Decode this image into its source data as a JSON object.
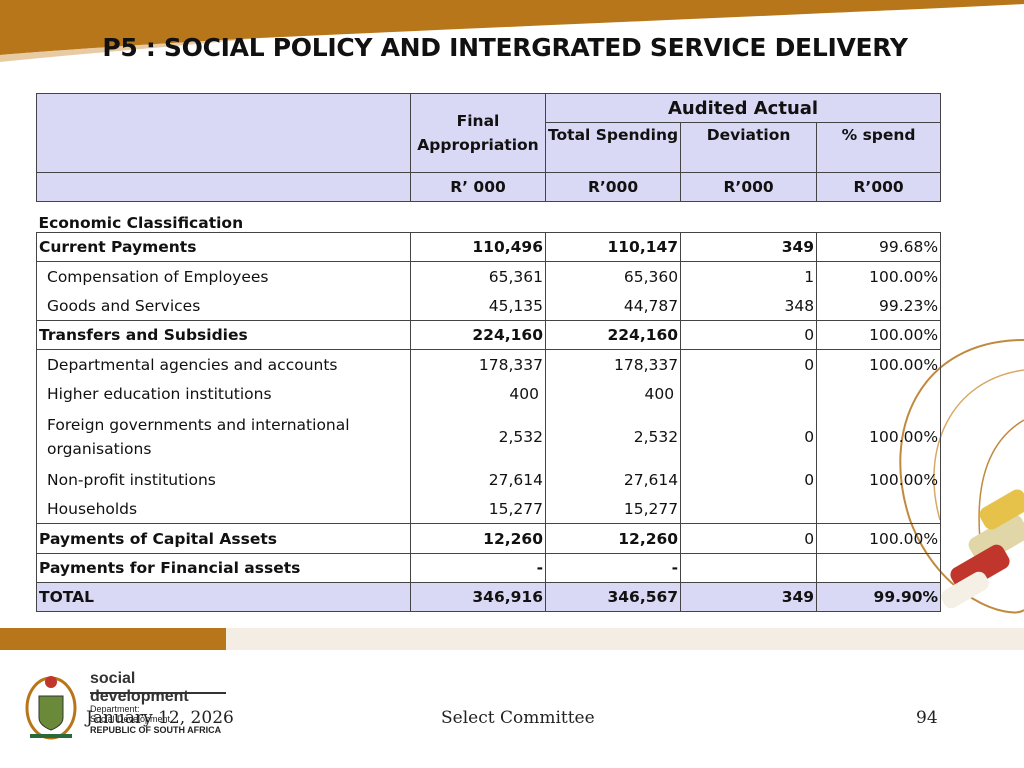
{
  "title": "P5 : SOCIAL POLICY AND INTERGRATED SERVICE DELIVERY",
  "header": {
    "final_appropriation": "Final Appropriation",
    "audited_actual": "Audited Actual",
    "total_spending": "Total Spending",
    "deviation": "Deviation",
    "pct_spend": "% spend",
    "unit_fa": "R’ 000",
    "unit_ts": "R’000",
    "unit_dev": "R’000",
    "unit_pct": "R’000"
  },
  "section_label": "Economic Classification",
  "rows": [
    {
      "label": "Current Payments",
      "fa": "110,496",
      "ts": "110,147",
      "dev": "349",
      "pct": "99.68%"
    },
    {
      "label": "Compensation of Employees",
      "fa": "65,361",
      "ts": "65,360",
      "dev": "1",
      "pct": "100.00%"
    },
    {
      "label": "Goods and Services",
      "fa": "45,135",
      "ts": "44,787",
      "dev": "348",
      "pct": "99.23%"
    },
    {
      "label": "Transfers and Subsidies",
      "fa": "224,160",
      "ts": "224,160",
      "dev": "0",
      "pct": "100.00%"
    },
    {
      "label": "Departmental agencies and accounts",
      "fa": "178,337",
      "ts": "178,337",
      "dev": "0",
      "pct": "100.00%"
    },
    {
      "label": "Higher education institutions",
      "fa": "400",
      "ts": "400",
      "dev": "",
      "pct": ""
    },
    {
      "label1": "Foreign governments and international",
      "label2": "organisations",
      "fa": "2,532",
      "ts": "2,532",
      "dev": "0",
      "pct": "100.00%"
    },
    {
      "label": "Non-profit institutions",
      "fa": "27,614",
      "ts": "27,614",
      "dev": "0",
      "pct": "100.00%"
    },
    {
      "label": "Households",
      "fa": "15,277",
      "ts": "15,277",
      "dev": "",
      "pct": ""
    },
    {
      "label": "Payments of Capital Assets",
      "fa": "12,260",
      "ts": "12,260",
      "dev": "0",
      "pct": "100.00%"
    },
    {
      "label": "Payments for Financial assets",
      "fa": "-",
      "ts": "-",
      "dev": "",
      "pct": ""
    },
    {
      "label": "TOTAL",
      "fa": "346,916",
      "ts": "346,567",
      "dev": "349",
      "pct": "99.90%"
    }
  ],
  "footer": {
    "date": "January 12, 2026",
    "center": "Select Committee",
    "page": "94"
  },
  "logo": {
    "line1": "social development",
    "line2": "Department:",
    "line3": "Social Development",
    "line4": "REPUBLIC OF SOUTH AFRICA"
  },
  "colors": {
    "band": "#b8761a",
    "header_fill": "#d9d8f5"
  }
}
